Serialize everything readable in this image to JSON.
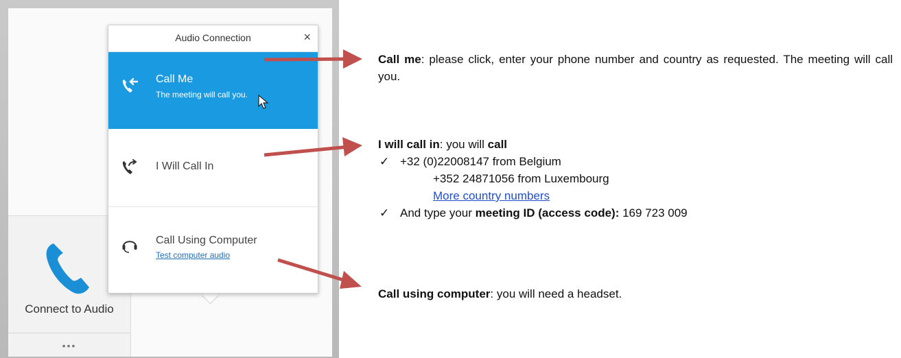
{
  "popup": {
    "title": "Audio Connection",
    "close_symbol": "×",
    "options": [
      {
        "title": "Call Me",
        "subtitle": "The meeting will call you.",
        "icon": "call-me-icon",
        "selected": true
      },
      {
        "title": "I Will Call In",
        "icon": "call-in-icon",
        "selected": false
      },
      {
        "title": "Call Using Computer",
        "subtitle": "Test computer audio",
        "icon": "headset-icon",
        "selected": false
      }
    ]
  },
  "connect": {
    "label": "Connect to Audio",
    "icon": "phone-icon",
    "more": "•••"
  },
  "colors": {
    "selected": "#1a9ae0",
    "arrow": "#c0504d",
    "link": "#1f4fd0",
    "phone": "#1a8fd6"
  },
  "annotations": {
    "call_me": {
      "bold": "Call me",
      "text": ": please click, enter your phone number and country as requested. The meeting will call you."
    },
    "call_in": {
      "bold": "I will call in",
      "text_a": ": you will ",
      "bold_b": "call",
      "check": "✓",
      "numbers": [
        {
          "number": "+32 (0)22008147 from Belgium"
        },
        {
          "number": "+352 24871056 from Luxembourg"
        }
      ],
      "more_link": "More country numbers",
      "id_text_a": "And type your ",
      "id_bold": "meeting ID (access code):",
      "id_value": " 169 723 009"
    },
    "computer": {
      "bold": "Call using computer",
      "text": ": you will need a headset."
    }
  }
}
